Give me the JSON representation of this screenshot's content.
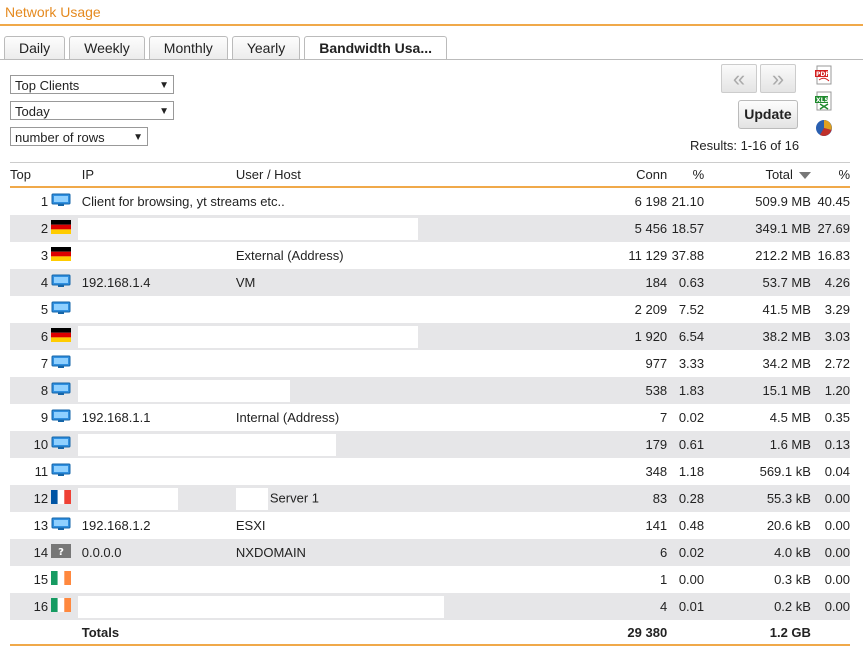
{
  "app_title": "Network Usage",
  "tabs": [
    "Daily",
    "Weekly",
    "Monthly",
    "Yearly",
    "Bandwidth Usa..."
  ],
  "filters": {
    "report": "Top Clients",
    "period": "Today",
    "rows": "number of rows"
  },
  "nav": {
    "prev": "«",
    "next": "»"
  },
  "update_label": "Update",
  "results_text": "Results: 1-16 of 16",
  "columns": {
    "top": "Top",
    "ip": "IP",
    "user": "User / Host",
    "conn": "Conn",
    "conn_pct": "%",
    "total": "Total",
    "total_pct": "%"
  },
  "rows": [
    {
      "rank": "1",
      "icon": "pc",
      "ip": "",
      "user": "",
      "note": "Client for browsing, yt streams etc..",
      "conn": "6 198",
      "conn_pct": "21.10",
      "total": "509.9 MB",
      "total_pct": "40.45"
    },
    {
      "rank": "2",
      "icon": "de",
      "ip": "",
      "user": "",
      "conn": "5 456",
      "conn_pct": "18.57",
      "total": "349.1 MB",
      "total_pct": "27.69"
    },
    {
      "rank": "3",
      "icon": "de",
      "ip": "",
      "user": "External (Address)",
      "conn": "11 129",
      "conn_pct": "37.88",
      "total": "212.2 MB",
      "total_pct": "16.83"
    },
    {
      "rank": "4",
      "icon": "pc",
      "ip": "192.168.1.4",
      "user": "VM",
      "conn": "184",
      "conn_pct": "0.63",
      "total": "53.7 MB",
      "total_pct": "4.26"
    },
    {
      "rank": "5",
      "icon": "pc",
      "ip": "",
      "user": "",
      "conn": "2 209",
      "conn_pct": "7.52",
      "total": "41.5 MB",
      "total_pct": "3.29"
    },
    {
      "rank": "6",
      "icon": "de",
      "ip": "",
      "user": "",
      "conn": "1 920",
      "conn_pct": "6.54",
      "total": "38.2 MB",
      "total_pct": "3.03"
    },
    {
      "rank": "7",
      "icon": "pc",
      "ip": "",
      "user": "",
      "conn": "977",
      "conn_pct": "3.33",
      "total": "34.2 MB",
      "total_pct": "2.72"
    },
    {
      "rank": "8",
      "icon": "pc",
      "ip": "",
      "user": "",
      "conn": "538",
      "conn_pct": "1.83",
      "total": "15.1 MB",
      "total_pct": "1.20"
    },
    {
      "rank": "9",
      "icon": "pc",
      "ip": "192.168.1.1",
      "user": "Internal (Address)",
      "conn": "7",
      "conn_pct": "0.02",
      "total": "4.5 MB",
      "total_pct": "0.35"
    },
    {
      "rank": "10",
      "icon": "pc",
      "ip": "",
      "user": "",
      "conn": "179",
      "conn_pct": "0.61",
      "total": "1.6 MB",
      "total_pct": "0.13"
    },
    {
      "rank": "11",
      "icon": "pc",
      "ip": "",
      "user": "",
      "conn": "348",
      "conn_pct": "1.18",
      "total": "569.1 kB",
      "total_pct": "0.04"
    },
    {
      "rank": "12",
      "icon": "fr",
      "ip": "",
      "user": "Server 1",
      "conn": "83",
      "conn_pct": "0.28",
      "total": "55.3 kB",
      "total_pct": "0.00"
    },
    {
      "rank": "13",
      "icon": "pc",
      "ip": "192.168.1.2",
      "user": "ESXI",
      "conn": "141",
      "conn_pct": "0.48",
      "total": "20.6 kB",
      "total_pct": "0.00"
    },
    {
      "rank": "14",
      "icon": "unknown",
      "ip": "0.0.0.0",
      "user": "NXDOMAIN",
      "conn": "6",
      "conn_pct": "0.02",
      "total": "4.0 kB",
      "total_pct": "0.00"
    },
    {
      "rank": "15",
      "icon": "ie",
      "ip": "",
      "user": "",
      "conn": "1",
      "conn_pct": "0.00",
      "total": "0.3 kB",
      "total_pct": "0.00"
    },
    {
      "rank": "16",
      "icon": "ie",
      "ip": "",
      "user": "",
      "conn": "4",
      "conn_pct": "0.01",
      "total": "0.2 kB",
      "total_pct": "0.00"
    }
  ],
  "totals": {
    "label": "Totals",
    "conn": "29 380",
    "total": "1.2 GB"
  },
  "colors": {
    "accent": "#f0a94a",
    "title": "#e58a1f",
    "row_alt": "#e6e6e8"
  }
}
